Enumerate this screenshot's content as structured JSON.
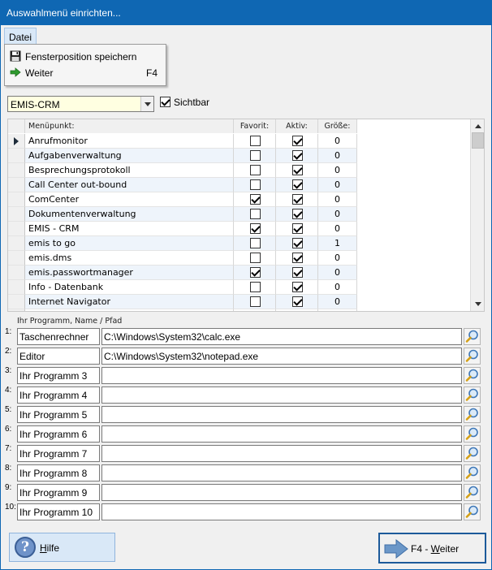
{
  "window": {
    "title": "Auswahlmenü einrichten..."
  },
  "menubar": {
    "datei": "Datei"
  },
  "file_menu": {
    "items": [
      {
        "label": "Fensterposition speichern",
        "shortcut": "",
        "icon": "floppy-disk-icon"
      },
      {
        "label": "Weiter",
        "shortcut": "F4",
        "icon": "green-arrow-icon"
      }
    ]
  },
  "selector": {
    "value": "EMIS-CRM",
    "visible_label": "Sichtbar",
    "visible_checked": true
  },
  "grid": {
    "headers": {
      "name": "Menüpunkt:",
      "fav": "Favorit:",
      "aktiv": "Aktiv:",
      "size": "Größe:"
    },
    "rows": [
      {
        "name": "Anrufmonitor",
        "fav": false,
        "aktiv": true,
        "size": "0"
      },
      {
        "name": "Aufgabenverwaltung",
        "fav": false,
        "aktiv": true,
        "size": "0"
      },
      {
        "name": "Besprechungsprotokoll",
        "fav": false,
        "aktiv": true,
        "size": "0"
      },
      {
        "name": "Call Center out-bound",
        "fav": false,
        "aktiv": true,
        "size": "0"
      },
      {
        "name": "ComCenter",
        "fav": true,
        "aktiv": true,
        "size": "0"
      },
      {
        "name": "Dokumentenverwaltung",
        "fav": false,
        "aktiv": true,
        "size": "0"
      },
      {
        "name": "EMIS - CRM",
        "fav": true,
        "aktiv": true,
        "size": "0"
      },
      {
        "name": "emis to go",
        "fav": false,
        "aktiv": true,
        "size": "1"
      },
      {
        "name": "emis.dms",
        "fav": false,
        "aktiv": true,
        "size": "0"
      },
      {
        "name": "emis.passwortmanager",
        "fav": true,
        "aktiv": true,
        "size": "0"
      },
      {
        "name": "Info - Datenbank",
        "fav": false,
        "aktiv": true,
        "size": "0"
      },
      {
        "name": "Internet Navigator",
        "fav": false,
        "aktiv": true,
        "size": "0"
      },
      {
        "name": "",
        "fav": false,
        "aktiv": false,
        "size": ""
      }
    ]
  },
  "programs": {
    "header": "Ihr Programm, Name / Pfad",
    "rows": [
      {
        "num": "1:",
        "name": "Taschenrechner",
        "path": "C:\\Windows\\System32\\calc.exe"
      },
      {
        "num": "2:",
        "name": "Editor",
        "path": "C:\\Windows\\System32\\notepad.exe"
      },
      {
        "num": "3:",
        "name": "Ihr Programm 3",
        "path": ""
      },
      {
        "num": "4:",
        "name": "Ihr Programm 4",
        "path": ""
      },
      {
        "num": "5:",
        "name": "Ihr Programm 5",
        "path": ""
      },
      {
        "num": "6:",
        "name": "Ihr Programm 6",
        "path": ""
      },
      {
        "num": "7:",
        "name": "Ihr Programm 7",
        "path": ""
      },
      {
        "num": "8:",
        "name": "Ihr Programm 8",
        "path": ""
      },
      {
        "num": "9:",
        "name": "Ihr Programm 9",
        "path": ""
      },
      {
        "num": "10:",
        "name": "Ihr Programm 10",
        "path": ""
      }
    ]
  },
  "footer": {
    "help_prefix": "H",
    "help_rest": "ilfe",
    "next_prefix": "F4 - ",
    "next_u": "W",
    "next_rest": "eiter"
  },
  "colors": {
    "accent": "#0f67b3",
    "combo_bg": "#ffffe1",
    "row_alt": "#eef4fb"
  }
}
